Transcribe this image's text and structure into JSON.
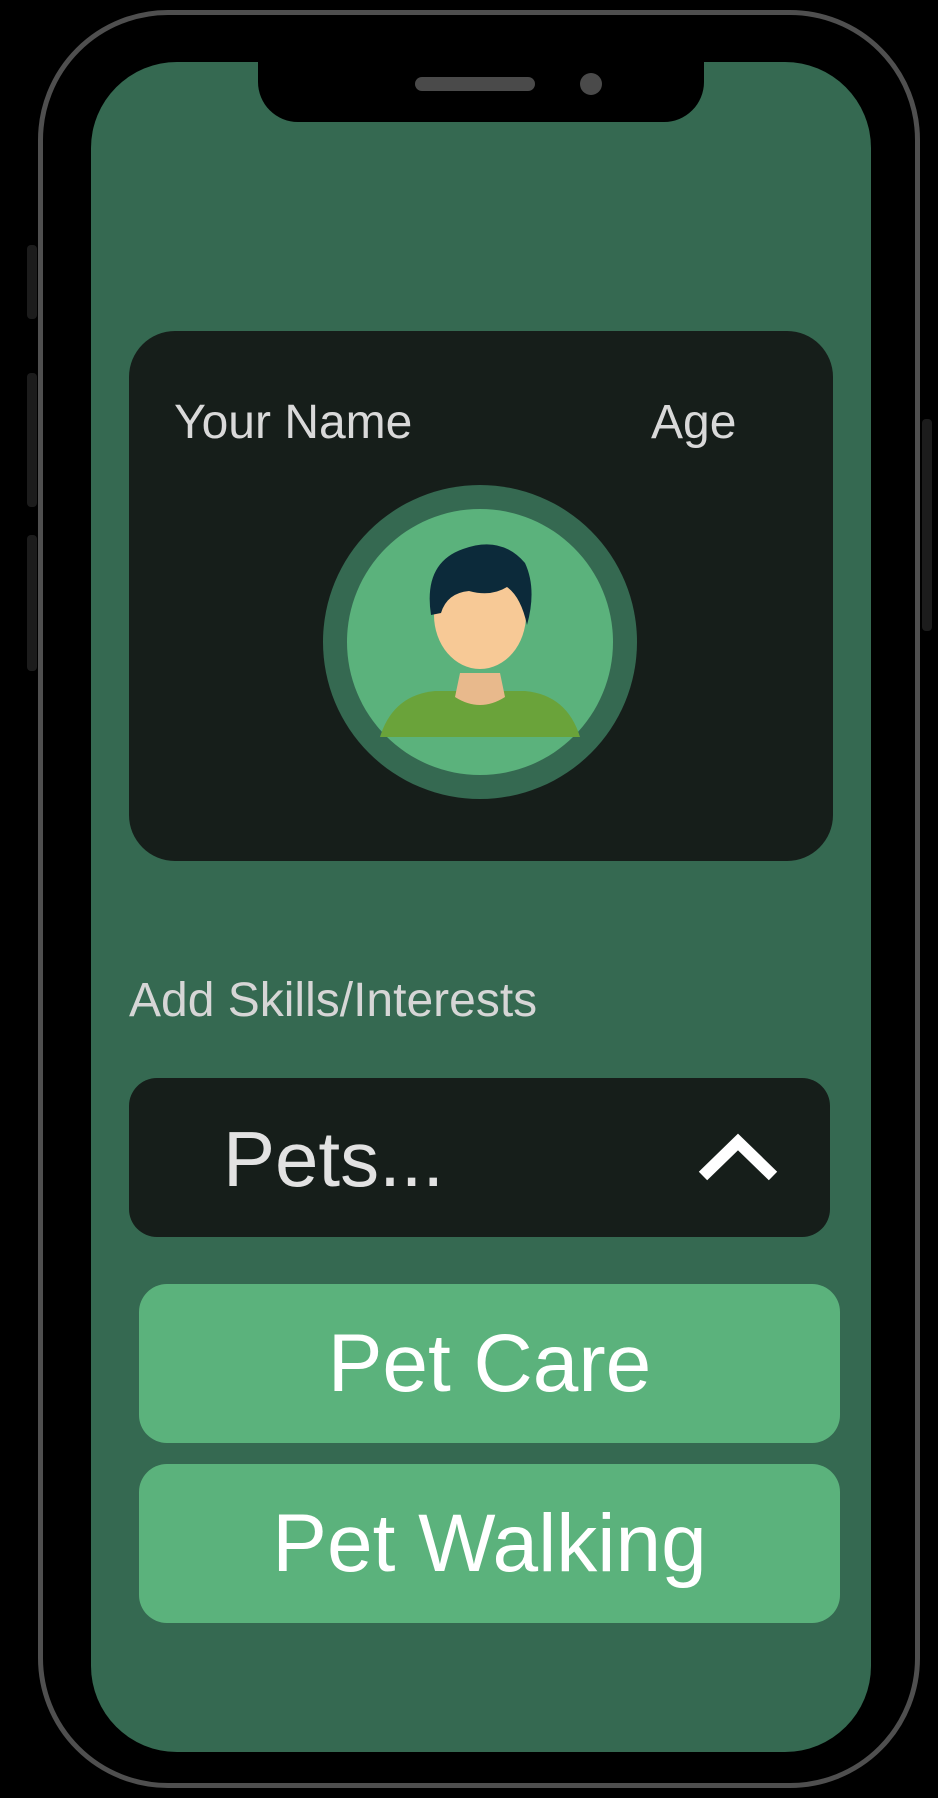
{
  "profile": {
    "name_label": "Your Name",
    "age_label": "Age",
    "avatar_icon": "user-avatar-icon"
  },
  "skills": {
    "section_label": "Add Skills/Interests",
    "dropdown_value": "Pets...",
    "dropdown_icon": "chevron-up-icon",
    "options": [
      {
        "label": "Pet Care"
      },
      {
        "label": "Pet Walking"
      }
    ]
  },
  "colors": {
    "screen_background": "#356951",
    "card_background": "#161e1a",
    "option_background": "#5bb27c",
    "frame_border": "#4f4f4f"
  }
}
